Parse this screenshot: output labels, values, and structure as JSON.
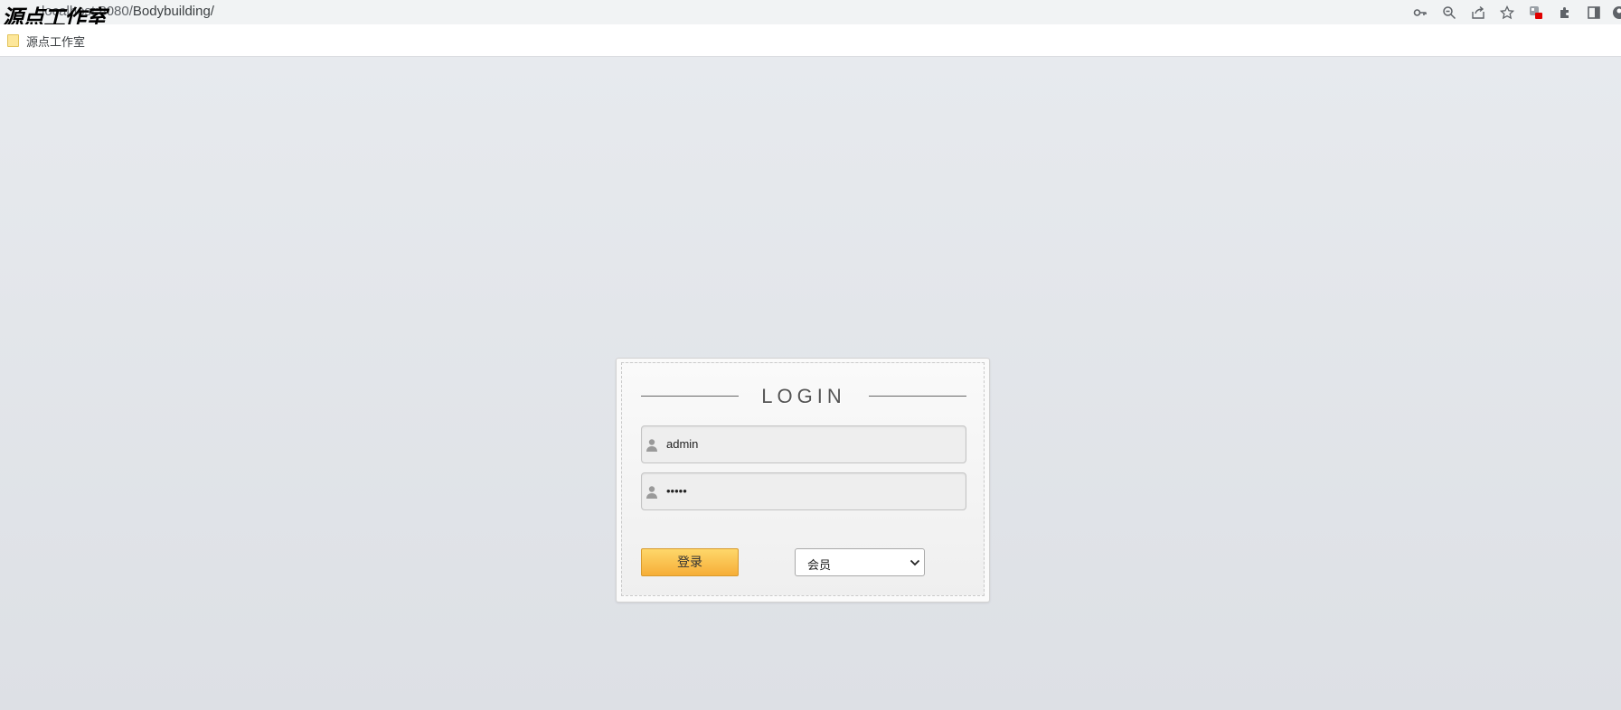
{
  "browser": {
    "url_prefix": "localhost:8080/",
    "url_path": "Bodybuilding/",
    "watermark": "源点工作室",
    "bookmark_label": "源点工作室"
  },
  "login": {
    "title": "LOGIN",
    "username_value": "admin",
    "password_value": "•••••",
    "submit_label": "登录",
    "role_selected": "会员"
  },
  "colors": {
    "page_background": "#e3e6eb",
    "button_gradient_top": "#fed76a",
    "button_gradient_bottom": "#f6ae38"
  }
}
